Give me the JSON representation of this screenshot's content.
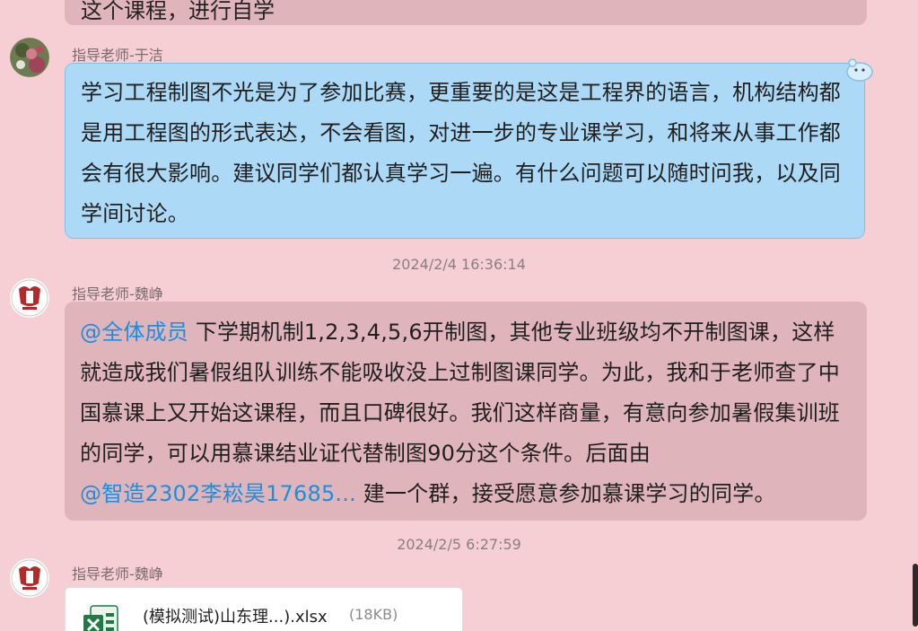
{
  "messages": [
    {
      "text": "这个课程，进行自学"
    },
    {
      "sender": "指导老师-于洁",
      "text": "学习工程制图不光是为了参加比赛，更重要的是这是工程界的语言，机构结构都是用工程图的形式表达，不会看图，对进一步的专业课学习，和将来从事工作都会有很大影响。建议同学们都认真学习一遍。有什么问题可以随时问我，以及同学间讨论。"
    },
    {
      "timestamp": "2024/2/4 16:36:14",
      "sender": "指导老师-魏峥",
      "mention1": "@全体成员",
      "text1": " 下学期机制1,2,3,4,5,6开制图，其他专业班级均不开制图课，这样就造成我们暑假组队训练不能吸收没上过制图课同学。为此，我和于老师查了中国慕课上又开始这课程，而且口碑很好。我们这样商量，有意向参加暑假集训班的同学，可以用慕课结业证代替制图90分这个条件。后面由",
      "mention2": "@智造2302李崧昊17685...",
      "text2": "  建一个群，接受愿意参加慕课学习的同学。"
    },
    {
      "timestamp": "2024/2/5 6:27:59",
      "sender": "指导老师-魏峥",
      "file_name": "(模拟测试)山东理...).xlsx",
      "file_size": "(18KB)"
    }
  ],
  "colors": {
    "background": "#f6cfd4",
    "self_bubble": "#acd9f6",
    "other_bubble": "#dfb4ba",
    "mention": "#1a8fe0"
  },
  "icons": [
    "avatar-flower",
    "avatar-emblem",
    "pet-icon",
    "excel-file-icon"
  ]
}
